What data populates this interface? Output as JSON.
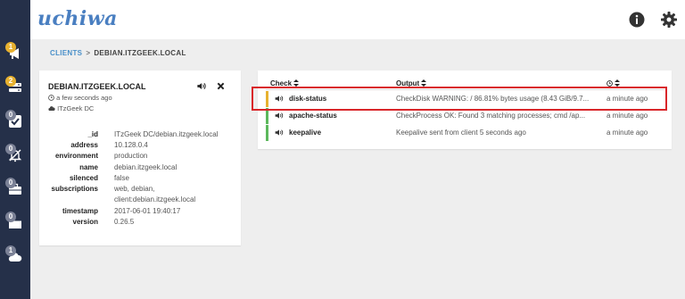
{
  "app": {
    "logo": "uchiwa"
  },
  "header": {
    "info_icon": "info-circle-icon",
    "settings_icon": "gear-icon"
  },
  "sidebar": {
    "items": [
      {
        "icon": "bullhorn-icon",
        "badge": "1",
        "status_color": "#e7b130"
      },
      {
        "icon": "server-icon",
        "badge": "2",
        "status_color": "#e7b130"
      },
      {
        "icon": "check-square-icon",
        "badge": "0",
        "status_color": "#7b8196"
      },
      {
        "icon": "silenced-bell-icon",
        "badge": "0",
        "status_color": "#7b8196"
      },
      {
        "icon": "briefcase-icon",
        "badge": "0",
        "status_color": "#7b8196"
      },
      {
        "icon": "folder-icon",
        "badge": "0",
        "status_color": "#7b8196"
      },
      {
        "icon": "cloud-icon",
        "badge": "1",
        "status_color": "#7b8196"
      }
    ]
  },
  "breadcrumb": {
    "parent": "CLIENTS",
    "separator": ">",
    "current": "DEBIAN.ITZGEEK.LOCAL"
  },
  "client": {
    "name": "DEBIAN.ITZGEEK.LOCAL",
    "last_seen": "a few seconds ago",
    "datacenter": "ITzGeek DC",
    "details": [
      {
        "key": "_id",
        "value": "ITzGeek DC/debian.itzgeek.local"
      },
      {
        "key": "address",
        "value": "10.128.0.4"
      },
      {
        "key": "environment",
        "value": "production"
      },
      {
        "key": "name",
        "value": "debian.itzgeek.local"
      },
      {
        "key": "silenced",
        "value": "false"
      },
      {
        "key": "subscriptions",
        "value": "web, debian,"
      },
      {
        "key": "",
        "value": "client:debian.itzgeek.local"
      },
      {
        "key": "timestamp",
        "value": "2017-06-01 19:40:17"
      },
      {
        "key": "version",
        "value": "0.26.5"
      }
    ]
  },
  "checks": {
    "columns": {
      "check": "Check",
      "output": "Output",
      "time_icon": "clock-icon"
    },
    "rows": [
      {
        "name": "disk-status",
        "output": "CheckDisk WARNING: / 86.81% bytes usage (8.43 GiB/9.7...",
        "time": "a minute ago",
        "status_color": "#e7b130"
      },
      {
        "name": "apache-status",
        "output": "CheckProcess OK: Found 3 matching processes; cmd /ap...",
        "time": "a minute ago",
        "status_color": "#5cb85c"
      },
      {
        "name": "keepalive",
        "output": "Keepalive sent from client 5 seconds ago",
        "time": "a minute ago",
        "status_color": "#5cb85c"
      }
    ]
  }
}
